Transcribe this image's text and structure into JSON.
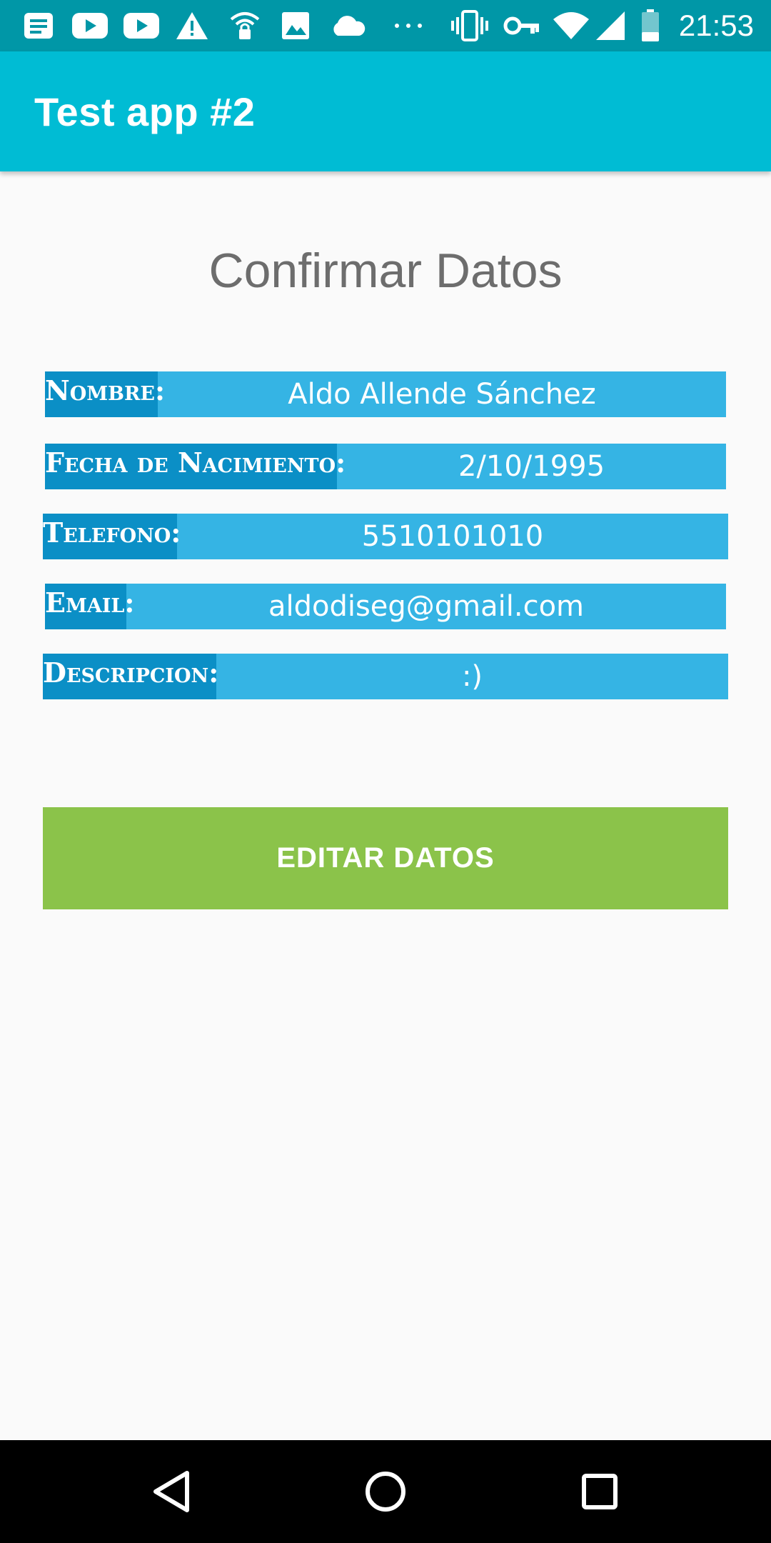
{
  "status_bar": {
    "time": "21:53",
    "icons": [
      "notes-icon",
      "youtube-icon",
      "youtube-icon",
      "warning-icon",
      "wifi-lock-icon",
      "image-icon",
      "cloud-icon",
      "more-dots-icon",
      "vibrate-icon",
      "vpn-key-icon",
      "wifi-icon",
      "signal-icon",
      "battery-icon"
    ],
    "background": "#0097a7"
  },
  "app_bar": {
    "title": "Test app #2",
    "color": "#00bcd4"
  },
  "main": {
    "heading": "Confirmar Datos",
    "fields": [
      {
        "label": "Nombre:",
        "value": "Aldo Allende Sánchez"
      },
      {
        "label": "Fecha de Nacimiento:",
        "value": "2/10/1995"
      },
      {
        "label": "Telefono:",
        "value": "5510101010"
      },
      {
        "label": "Email:",
        "value": "aldodiseg@gmail.com"
      },
      {
        "label": "Descripcion:",
        "value": ":)"
      }
    ],
    "label_bg": "#0b8fc6",
    "value_bg": "#35b4e4",
    "edit_button_label": "EDITAR DATOS",
    "edit_button_color": "#8bc34a"
  },
  "nav_bar": {
    "buttons": [
      "back-icon",
      "home-icon",
      "recents-icon"
    ]
  }
}
